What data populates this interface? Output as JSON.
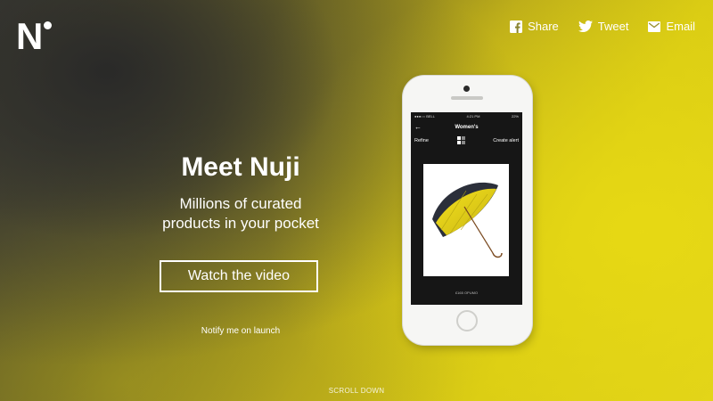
{
  "brand": {
    "logo_letter": "N"
  },
  "social": [
    {
      "label": "Share",
      "icon": "facebook-icon"
    },
    {
      "label": "Tweet",
      "icon": "twitter-icon"
    },
    {
      "label": "Email",
      "icon": "email-icon"
    }
  ],
  "hero": {
    "title": "Meet Nuji",
    "subtitle_line1": "Millions of curated",
    "subtitle_line2": "products in your pocket",
    "cta_label": "Watch the video",
    "notify_label": "Notify me on launch"
  },
  "footer": {
    "scroll_label": "SCROLL DOWN"
  },
  "phone": {
    "status_carrier": "●●●○○ BELL",
    "status_time": "4:21 PM",
    "status_battery": "22%",
    "header_title": "Women's",
    "refine_label": "Refine",
    "create_alert_label": "Create alert",
    "price_label": "£165 OPUMO"
  },
  "colors": {
    "accent": "#e0d21a",
    "dark": "#3b3a33"
  }
}
